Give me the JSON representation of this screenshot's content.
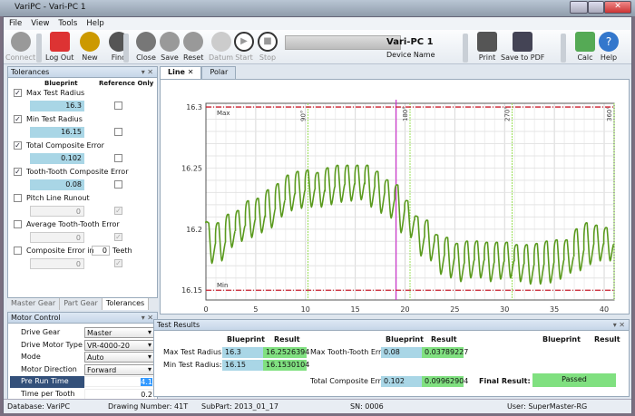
{
  "window": {
    "title": "VariPC - Vari-PC 1"
  },
  "menu": [
    "File",
    "View",
    "Tools",
    "Help"
  ],
  "toolbar": {
    "buttons": [
      {
        "label": "Connect",
        "icon": "database-icon",
        "enabled": false
      },
      {
        "label": "Log Out",
        "icon": "power-icon",
        "enabled": true
      },
      {
        "label": "New",
        "icon": "magic-wand-icon",
        "enabled": true
      },
      {
        "label": "Find",
        "icon": "binoculars-icon",
        "enabled": true
      },
      {
        "label": "Close",
        "icon": "close-icon",
        "enabled": true
      },
      {
        "label": "Save",
        "icon": "database-add-icon",
        "enabled": true
      },
      {
        "label": "Reset",
        "icon": "database-reset-icon",
        "enabled": true
      },
      {
        "label": "Datum",
        "icon": "gear-icon",
        "enabled": false
      },
      {
        "label": "Start",
        "icon": "play-icon",
        "enabled": false
      },
      {
        "label": "Stop",
        "icon": "stop-icon",
        "enabled": false
      },
      {
        "label": "Print",
        "icon": "printer-icon",
        "enabled": true
      },
      {
        "label": "Save to PDF",
        "icon": "floppy-icon",
        "enabled": true
      },
      {
        "label": "Calc",
        "icon": "calculator-icon",
        "enabled": true
      },
      {
        "label": "Help",
        "icon": "help-icon",
        "enabled": true
      }
    ],
    "device_name": "Vari-PC 1",
    "device_label": "Device Name"
  },
  "tolerances": {
    "title": "Tolerances",
    "col_blueprint": "Blueprint",
    "col_reference": "Reference Only",
    "items": [
      {
        "label": "Max Test Radius",
        "checked": true,
        "value": "16.3",
        "reference": false
      },
      {
        "label": "Min Test Radius",
        "checked": true,
        "value": "16.15",
        "reference": false
      },
      {
        "label": "Total Composite Error",
        "checked": true,
        "value": "0.102",
        "reference": false
      },
      {
        "label": "Tooth-Tooth Composite Error",
        "checked": true,
        "value": "0.08",
        "reference": false
      },
      {
        "label": "Pitch Line Runout",
        "checked": false,
        "value": "0",
        "reference": true
      },
      {
        "label": "Average Tooth-Tooth Error",
        "checked": false,
        "value": "0",
        "reference": true
      },
      {
        "label": "Composite Error in",
        "checked": false,
        "value": "0",
        "reference": true,
        "teeth": "0",
        "teeth_label": "Teeth"
      }
    ],
    "tabs": [
      "Master Gear",
      "Part Gear",
      "Tolerances"
    ],
    "active_tab": "Tolerances"
  },
  "motor": {
    "title": "Motor Control",
    "rows": [
      {
        "label": "Drive Gear",
        "value": "Master",
        "type": "select"
      },
      {
        "label": "Drive Motor Type",
        "value": "VR-4000-20",
        "type": "select"
      },
      {
        "label": "Mode",
        "value": "Auto",
        "type": "select"
      },
      {
        "label": "Motor Direction",
        "value": "Forward",
        "type": "select"
      },
      {
        "label": "Pre Run Time",
        "value": "4.1",
        "type": "text",
        "selected": true
      },
      {
        "label": "Time per Tooth",
        "value": "0.2",
        "type": "text"
      }
    ]
  },
  "chart_tabs": [
    "Line",
    "Polar"
  ],
  "active_chart_tab": "Line",
  "chart_data": {
    "type": "line",
    "xlim": [
      0,
      41
    ],
    "ylim": [
      16.142,
      16.303
    ],
    "xticks": [
      0,
      5,
      10,
      15,
      20,
      25,
      30,
      35,
      40
    ],
    "yticks": [
      16.15,
      16.2,
      16.25,
      16.3
    ],
    "grid": true,
    "line_color": "#5a9a1e",
    "limits": [
      {
        "label": "Max",
        "y": 16.3,
        "color": "#cc1f2f"
      },
      {
        "label": "Min",
        "y": 16.15,
        "color": "#cc1f2f"
      }
    ],
    "angle_markers": [
      {
        "label": "90°",
        "x": 10.25
      },
      {
        "label": "180°",
        "x": 20.5
      },
      {
        "label": "270°",
        "x": 30.75
      },
      {
        "label": "360°",
        "x": 41
      }
    ],
    "cursor_x": 19.1,
    "cursor_color": "#cc33cc",
    "peaks": [
      16.205,
      16.205,
      16.212,
      16.215,
      16.223,
      16.225,
      16.232,
      16.237,
      16.244,
      16.247,
      16.248,
      16.246,
      16.25,
      16.252,
      16.252,
      16.252,
      16.252,
      16.247,
      16.24,
      16.236,
      16.223,
      16.21,
      16.207,
      16.195,
      16.193,
      16.188,
      16.19,
      16.19,
      16.189,
      16.189,
      16.189,
      16.187,
      16.187,
      16.188,
      16.19,
      16.191,
      16.191,
      16.2,
      16.205,
      16.203,
      16.201
    ],
    "troughs": [
      16.172,
      16.174,
      16.185,
      16.19,
      16.193,
      16.197,
      16.201,
      16.21,
      16.215,
      16.217,
      16.218,
      16.218,
      16.22,
      16.222,
      16.223,
      16.224,
      16.218,
      16.213,
      16.209,
      16.197,
      16.193,
      16.178,
      16.174,
      16.163,
      16.16,
      16.157,
      16.16,
      16.16,
      16.157,
      16.159,
      16.16,
      16.157,
      16.155,
      16.155,
      16.156,
      16.159,
      16.164,
      16.166,
      16.171,
      16.174,
      16.174
    ],
    "peak_x_offset": 0.1,
    "trough_x_offset": 0.6
  },
  "results": {
    "title": "Test Results",
    "col_blueprint": "Blueprint",
    "col_result": "Result",
    "max_radius": {
      "label": "Max Test Radius:",
      "blueprint": "16.3",
      "result": "16.2526394"
    },
    "min_radius": {
      "label": "Min Test Radius:",
      "blueprint": "16.15",
      "result": "16.1530104"
    },
    "max_tt": {
      "label": "Max Tooth-Tooth Err:",
      "blueprint": "0.08",
      "result": "0.03789227"
    },
    "tce": {
      "label": "Total Composite Err:",
      "blueprint": "0.102",
      "result": "0.09962904"
    },
    "final": {
      "label": "Final Result:",
      "value": "Passed"
    }
  },
  "status": {
    "database": "Database: VariPC",
    "drawing": "Drawing Number: 41T",
    "subpart": "SubPart: 2013_01_17",
    "sn": "SN: 0006",
    "user": "User: SuperMaster-RG"
  }
}
